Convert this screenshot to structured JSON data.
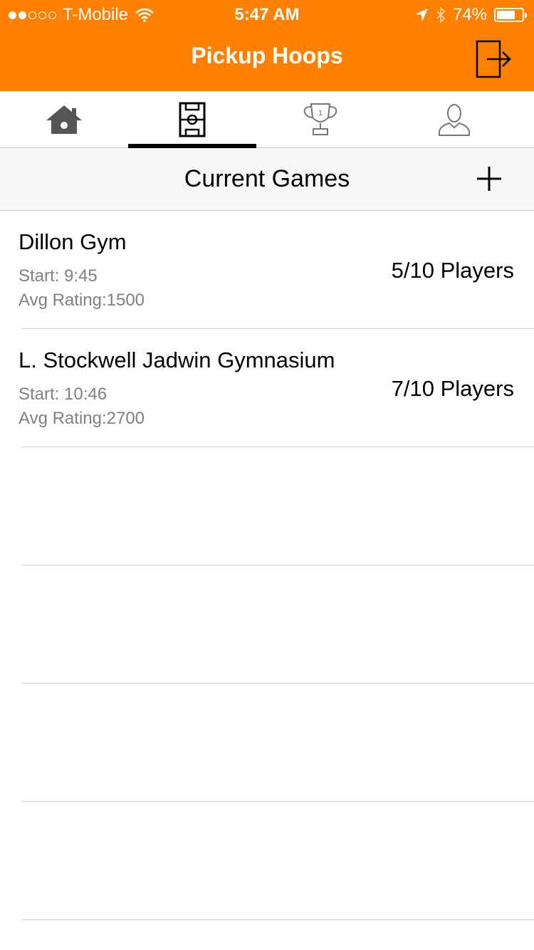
{
  "status_bar": {
    "carrier": "T-Mobile",
    "signal_bars_filled": 2,
    "signal_bars_total": 5,
    "time": "5:47 AM",
    "battery": "74%",
    "battery_level": 0.74
  },
  "nav": {
    "title": "Pickup Hoops",
    "logout_icon": "logout-icon"
  },
  "tabs": [
    {
      "id": "home",
      "icon": "house-icon",
      "selected": false
    },
    {
      "id": "games",
      "icon": "court-icon",
      "selected": true
    },
    {
      "id": "leaderboard",
      "icon": "trophy-icon",
      "selected": false
    },
    {
      "id": "profile",
      "icon": "person-icon",
      "selected": false
    }
  ],
  "section": {
    "title": "Current Games",
    "add_icon": "plus-icon"
  },
  "games": [
    {
      "name": "Dillon Gym",
      "start": "Start: 9:45",
      "rating": "Avg Rating:1500",
      "players": "5/10 Players"
    },
    {
      "name": "L. Stockwell Jadwin Gymnasium",
      "start": "Start: 10:46",
      "rating": "Avg Rating:2700",
      "players": "7/10 Players"
    }
  ],
  "colors": {
    "accent": "#ff8000",
    "secondary_text": "#808080",
    "separator": "#d0d0d0"
  }
}
